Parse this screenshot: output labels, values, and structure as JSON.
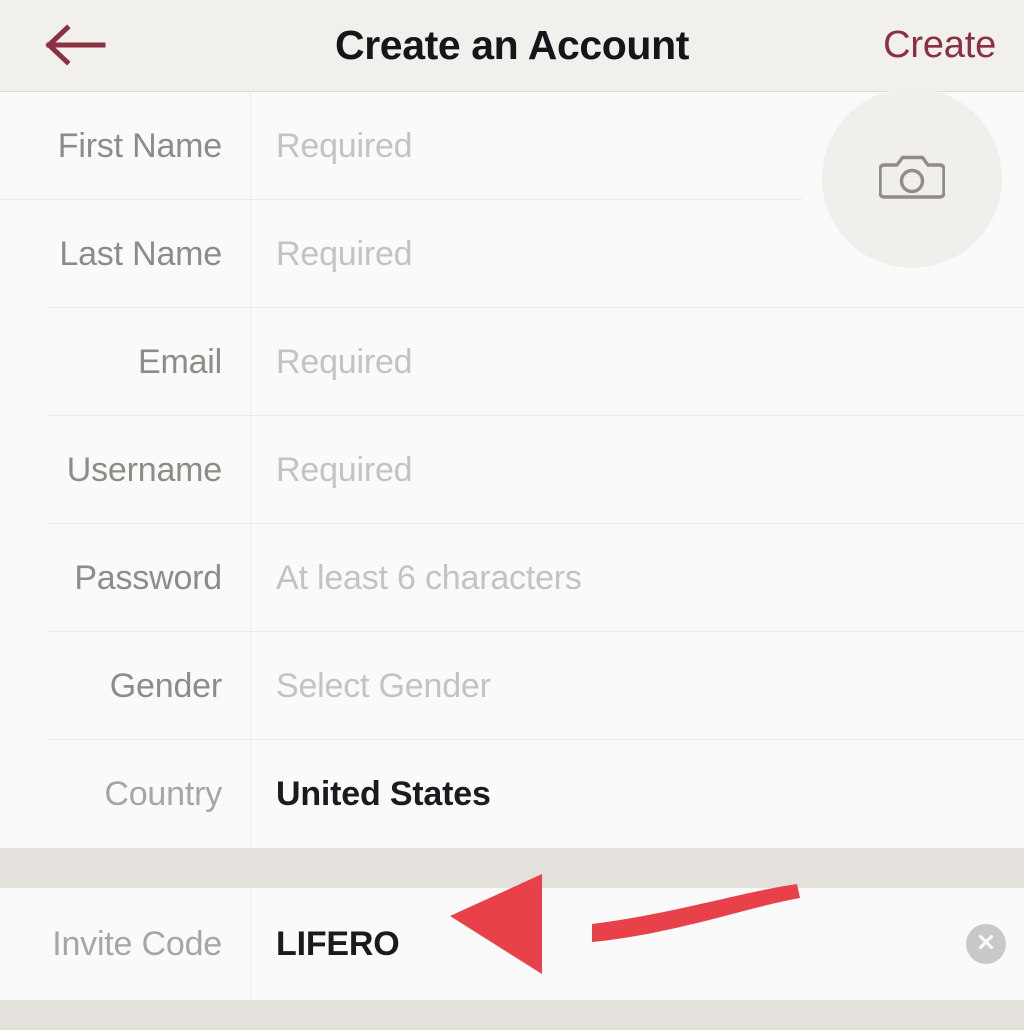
{
  "header": {
    "back_icon": "back-arrow-icon",
    "title": "Create an Account",
    "action_label": "Create",
    "accent_color": "#8a3041",
    "background_color": "#f2f0ec"
  },
  "avatar": {
    "icon": "camera-icon",
    "background_color": "#f1efeb"
  },
  "form": {
    "fields": [
      {
        "label": "First Name",
        "value": "",
        "placeholder": "Required",
        "filled": false
      },
      {
        "label": "Last Name",
        "value": "",
        "placeholder": "Required",
        "filled": false
      },
      {
        "label": "Email",
        "value": "",
        "placeholder": "Required",
        "filled": false
      },
      {
        "label": "Username",
        "value": "",
        "placeholder": "Required",
        "filled": false
      },
      {
        "label": "Password",
        "value": "",
        "placeholder": "At least 6 characters",
        "filled": false
      },
      {
        "label": "Gender",
        "value": "",
        "placeholder": "Select Gender",
        "filled": false
      },
      {
        "label": "Country",
        "value": "United States",
        "placeholder": "",
        "filled": true
      }
    ]
  },
  "invite": {
    "label": "Invite Code",
    "value": "LIFERO",
    "clear_icon": "clear-circle-icon"
  },
  "annotation": {
    "arrow_icon": "red-pointer-arrow-icon",
    "color": "#e8414a"
  },
  "colors": {
    "row_background": "#fafafa",
    "section_gap": "#e4e1dc",
    "label_text": "#8d8d88",
    "placeholder_text": "#c3c3c6",
    "value_text": "#1b1b1f",
    "divider": "#eceae8"
  }
}
